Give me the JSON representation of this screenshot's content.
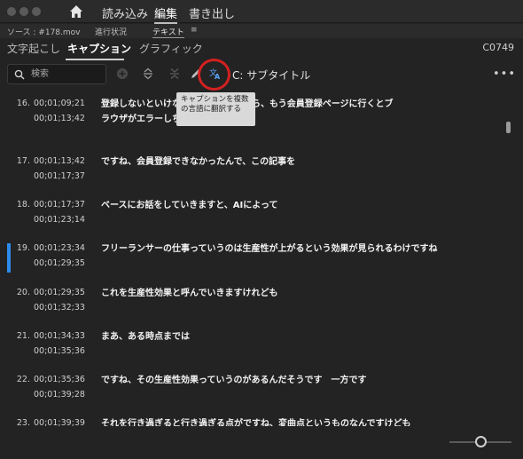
{
  "topbar": {
    "menu": [
      "読み込み",
      "編集",
      "書き出し"
    ],
    "active_menu": "編集"
  },
  "subheader": {
    "source": "ソース : #178.mov",
    "progress": "進行状況",
    "text_tab": "テキスト",
    "text_menu_icon": "≡"
  },
  "tabs": {
    "items": [
      "文字起こし",
      "キャプション",
      "グラフィック"
    ],
    "active": "キャプション",
    "code": "C0749"
  },
  "toolbar": {
    "search_placeholder": "検索",
    "subtitle_label": "C: サブタイトル",
    "more": "•••",
    "tooltip": "キャプションを複数の言語に翻訳する"
  },
  "captions": [
    {
      "num": "16.",
      "in": "00;01;09;21",
      "out": "00;01;13;42",
      "text": "登録しないといけないのかなと思ったら、もう会員登録ページに行くとブラウザがエラーしちゃって",
      "selected": false
    },
    {
      "num": "17.",
      "in": "00;01;13;42",
      "out": "00;01;17;37",
      "text": "ですね、会員登録できなかったんで、この記事を",
      "selected": false
    },
    {
      "num": "18.",
      "in": "00;01;17;37",
      "out": "00;01;23;14",
      "text": "ベースにお話をしていきますと、AIによって",
      "selected": false
    },
    {
      "num": "19.",
      "in": "00;01;23;34",
      "out": "00;01;29;35",
      "text": "フリーランサーの仕事っていうのは生産性が上がるという効果が見られるわけですね",
      "selected": true
    },
    {
      "num": "20.",
      "in": "00;01;29;35",
      "out": "00;01;32;33",
      "text": "これを生産性効果と呼んでいきますけれども",
      "selected": false
    },
    {
      "num": "21.",
      "in": "00;01;34;33",
      "out": "00;01;35;36",
      "text": "まあ、ある時点までは",
      "selected": false
    },
    {
      "num": "22.",
      "in": "00;01;35;36",
      "out": "00;01;39;28",
      "text": "ですね、その生産性効果っていうのがあるんだそうです　一方です",
      "selected": false
    },
    {
      "num": "23.",
      "in": "00;01;39;39",
      "out": "",
      "text": "それを行き過ぎると行き過ぎる点がですね、変曲点というものなんですけども",
      "selected": false
    }
  ],
  "colors": {
    "background": "#232323",
    "accent_blue": "#2d8ceb",
    "highlight_red": "#d42020"
  }
}
